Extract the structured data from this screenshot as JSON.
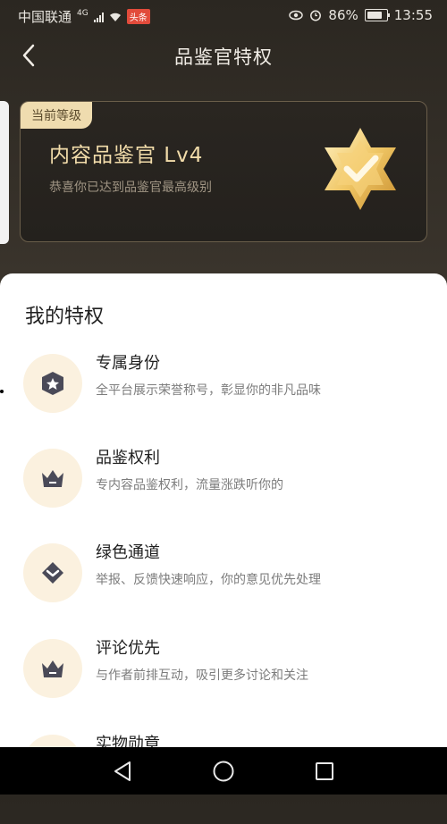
{
  "status": {
    "carrier": "中国联通",
    "network": "4G",
    "app_badge": "头条",
    "battery": "86%",
    "time": "13:55"
  },
  "nav": {
    "title": "品鉴官特权"
  },
  "level_card": {
    "tag": "当前等级",
    "name": "内容品鉴官 Lv4",
    "subtitle": "恭喜你已达到品鉴官最高级别"
  },
  "privileges": {
    "section_title": "我的特权",
    "items": [
      {
        "title": "专属身份",
        "desc": "全平台展示荣誉称号，彰显你的非凡品味",
        "icon": "shield-star-icon"
      },
      {
        "title": "品鉴权利",
        "desc": "专内容品鉴权利，流量涨跌听你的",
        "icon": "crown-icon"
      },
      {
        "title": "绿色通道",
        "desc": "举报、反馈快速响应，你的意见优先处理",
        "icon": "diamond-shield-icon"
      },
      {
        "title": "评论优先",
        "desc": "与作者前排互动，吸引更多讨论和关注",
        "icon": "crown-icon"
      },
      {
        "title": "实物勋章",
        "desc": "",
        "icon": "medal-icon"
      }
    ]
  },
  "colors": {
    "accent_gold": "#f2dcaa",
    "icon_bg": "#fbf1df",
    "icon_dark": "#4a4a58"
  }
}
